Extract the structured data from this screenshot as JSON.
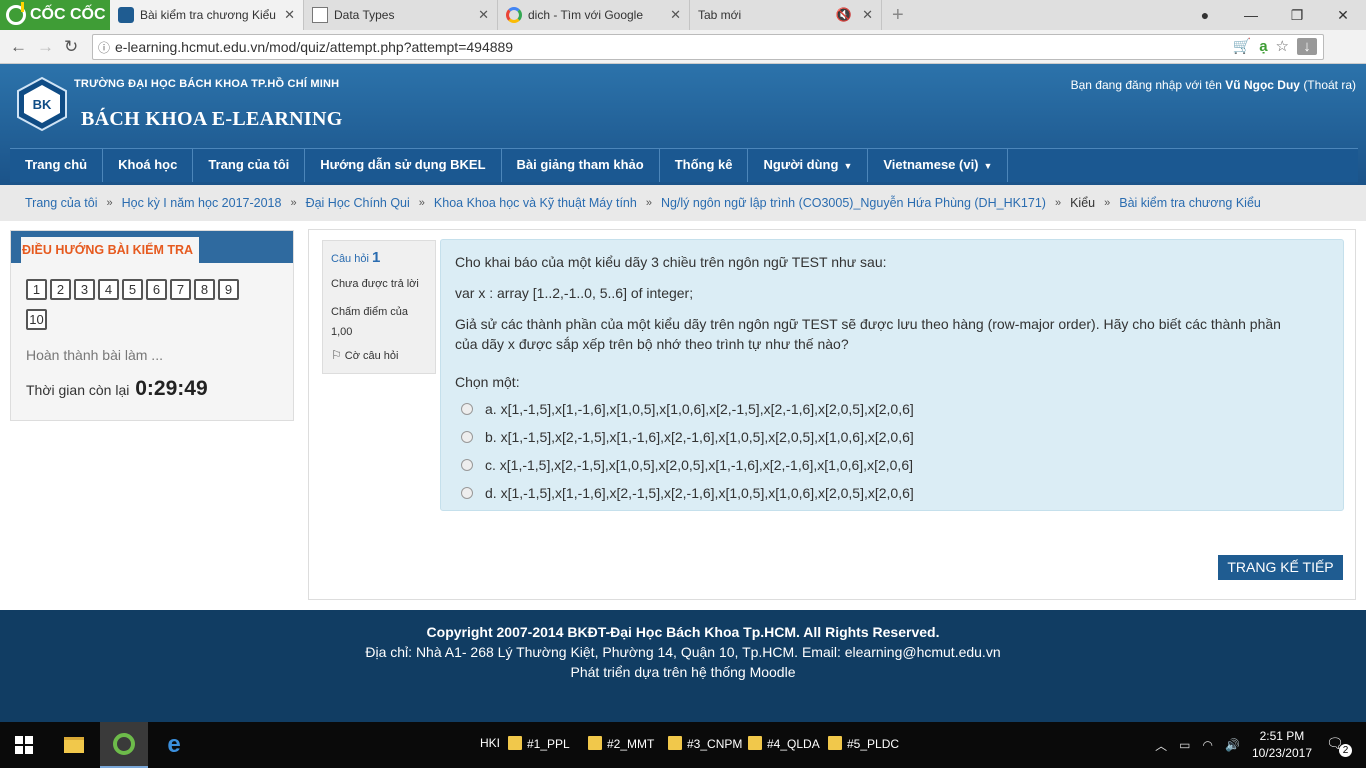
{
  "browser": {
    "brand": "CỐC CỐC",
    "tabs": [
      {
        "label": "Bài kiểm tra chương Kiểu"
      },
      {
        "label": "Data Types"
      },
      {
        "label": "dich - Tìm với Google"
      },
      {
        "label": "Tab mới"
      }
    ],
    "url": "e-learning.hcmut.edu.vn/mod/quiz/attempt.php?attempt=494889"
  },
  "site": {
    "university": "TRƯỜNG ĐẠI HỌC BÁCH KHOA TP.HỒ CHÍ MINH",
    "name": "BÁCH KHOA E-LEARNING",
    "logo_text": "BK",
    "login_prefix": "Bạn đang đăng nhập với tên",
    "user": "Vũ Ngọc Duy",
    "logout": "(Thoát ra)"
  },
  "menu": {
    "items": [
      {
        "label": "Trang chủ"
      },
      {
        "label": "Khoá học"
      },
      {
        "label": "Trang của tôi"
      },
      {
        "label": "Hướng dẫn sử dụng BKEL"
      },
      {
        "label": "Bài giảng tham khảo"
      },
      {
        "label": "Thống kê"
      },
      {
        "label": "Người dùng"
      },
      {
        "label": "Vietnamese (vi)"
      }
    ]
  },
  "breadcrumb": [
    "Trang của tôi",
    "Học kỳ I năm học 2017-2018",
    "Đại Học Chính Qui",
    "Khoa Khoa học và Kỹ thuật Máy tính",
    "Ng/lý ngôn ngữ lập trình (CO3005)_Nguyễn Hứa Phùng (DH_HK171)",
    "Kiểu",
    "Bài kiểm tra chương Kiểu"
  ],
  "quiz_nav": {
    "title": "ĐIỀU HƯỚNG BÀI KIỂM TRA",
    "buttons": [
      "1",
      "2",
      "3",
      "4",
      "5",
      "6",
      "7",
      "8",
      "9",
      "10"
    ],
    "finish": "Hoàn thành bài làm ...",
    "timer_label": "Thời gian còn lại",
    "timer_value": "0:29:49"
  },
  "question": {
    "label": "Câu hỏi",
    "number": "1",
    "state": "Chưa được trả lời",
    "grade": "Chấm điểm của 1,00",
    "flag": "Cờ câu hỏi",
    "text1": "Cho khai báo của một kiểu dãy 3 chiều trên ngôn ngữ TEST như sau:",
    "text2": "var x : array [1..2,-1..0, 5..6] of integer;",
    "text3": "Giả sử các thành phần của một kiểu dãy trên ngôn ngữ TEST sẽ được lưu theo hàng (row-major order). Hãy cho biết các thành phần của dãy x được sắp xếp trên bộ nhớ theo trình tự như thế nào?",
    "prompt": "Chọn một:",
    "options": [
      "a. x[1,-1,5],x[1,-1,6],x[1,0,5],x[1,0,6],x[2,-1,5],x[2,-1,6],x[2,0,5],x[2,0,6]",
      "b. x[1,-1,5],x[2,-1,5],x[1,-1,6],x[2,-1,6],x[1,0,5],x[2,0,5],x[1,0,6],x[2,0,6]",
      "c. x[1,-1,5],x[2,-1,5],x[1,0,5],x[2,0,5],x[1,-1,6],x[2,-1,6],x[1,0,6],x[2,0,6]",
      "d. x[1,-1,5],x[1,-1,6],x[2,-1,5],x[2,-1,6],x[1,0,5],x[1,0,6],x[2,0,5],x[2,0,6]"
    ],
    "next_button": "TRANG KẾ TIẾP"
  },
  "footer": {
    "copyright": "Copyright 2007-2014 BKĐT-Đại Học Bách Khoa Tp.HCM. All Rights Reserved.",
    "address": "Địa chỉ: Nhà A1- 268 Lý Thường Kiệt, Phường 14, Quận 10, Tp.HCM. Email: elearning@hcmut.edu.vn",
    "moodle": "Phát triển dựa trên hệ thống Moodle"
  },
  "taskbar": {
    "folder_group": "HKI",
    "folders": [
      "#1_PPL",
      "#2_MMT",
      "#3_CNPM",
      "#4_QLDA",
      "#5_PLDC"
    ],
    "time": "2:51 PM",
    "date": "10/23/2017",
    "notifications": "2"
  },
  "colors": {
    "header": "#1f5c91",
    "link": "#2a6cb0",
    "nav_title": "#e65a1f",
    "question_bg": "#dbedf5",
    "footer": "#113d63"
  }
}
